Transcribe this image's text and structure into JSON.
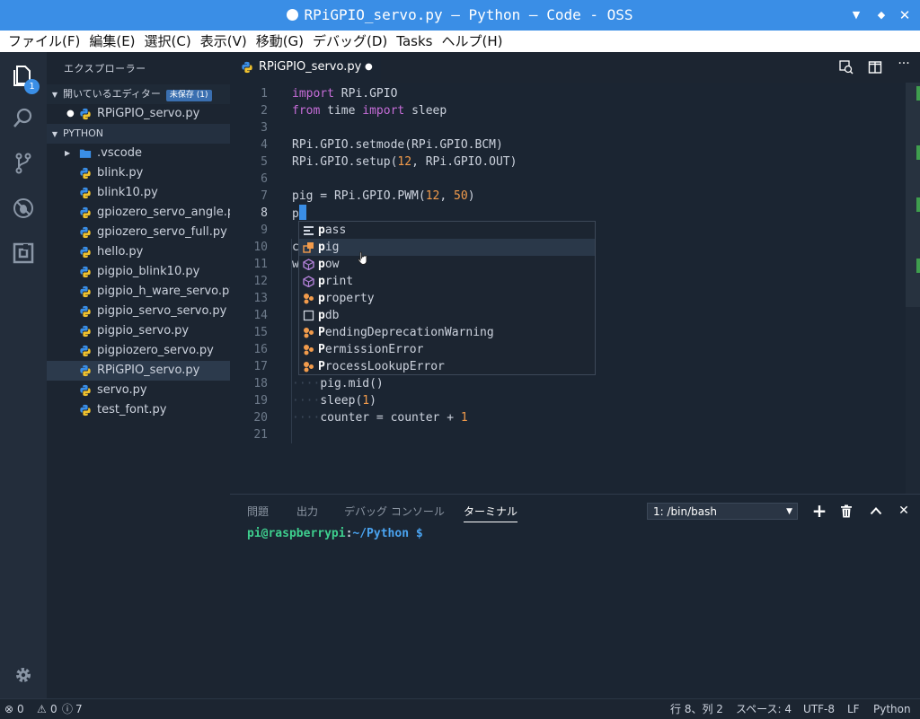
{
  "window": {
    "title": "RPiGPIO_servo.py — Python — Code - OSS"
  },
  "menu": [
    "ファイル(F)",
    "編集(E)",
    "選択(C)",
    "表示(V)",
    "移動(G)",
    "デバッグ(D)",
    "Tasks",
    "ヘルプ(H)"
  ],
  "activity": {
    "explorer_badge": "1"
  },
  "sidebar": {
    "header": "エクスプローラー",
    "open_editors": {
      "label": "開いているエディター",
      "unsaved": "未保存 (1)",
      "items": [
        "RPiGPIO_servo.py"
      ]
    },
    "folder": {
      "label": "PYTHON",
      "items": [
        ".vscode",
        "blink.py",
        "blink10.py",
        "gpiozero_servo_angle.py",
        "gpiozero_servo_full.py",
        "hello.py",
        "pigpio_blink10.py",
        "pigpio_h_ware_servo.py",
        "pigpio_servo_servo.py",
        "pigpio_servo.py",
        "pigpiozero_servo.py",
        "RPiGPIO_servo.py",
        "servo.py",
        "test_font.py"
      ],
      "selected": "RPiGPIO_servo.py"
    }
  },
  "editor": {
    "tab_label": "RPiGPIO_servo.py",
    "line_numbers": [
      "1",
      "2",
      "3",
      "4",
      "5",
      "6",
      "7",
      "8",
      "9",
      "10",
      "11",
      "12",
      "13",
      "14",
      "15",
      "16",
      "17",
      "18",
      "19",
      "20",
      "21"
    ],
    "lines": {
      "l1_kw": "import",
      "l1_rest": " RPi.GPIO",
      "l2_kw1": "from",
      "l2_mid": " time ",
      "l2_kw2": "import",
      "l2_rest": " sleep",
      "l4": "RPi.GPIO.setmode(RPi.GPIO.BCM)",
      "l5_a": "RPi.GPIO.setup(",
      "l5_num": "12",
      "l5_b": ", RPi.GPIO.OUT)",
      "l7_a": "pig = RPi.GPIO.PWM(",
      "l7_num1": "12",
      "l7_sep": ", ",
      "l7_num2": "50",
      "l7_b": ")",
      "l8": "p",
      "l10": "c",
      "l11": "w",
      "l18_ws": "····",
      "l18": "pig.mid()",
      "l19_ws": "····",
      "l19_a": "sleep(",
      "l19_num": "1",
      "l19_b": ")",
      "l20_ws": "····",
      "l20_a": "counter = counter + ",
      "l20_num": "1"
    },
    "suggestions": [
      {
        "match": "p",
        "rest": "ass",
        "icon": "keyword-icon"
      },
      {
        "match": "p",
        "rest": "ig",
        "icon": "variable-icon"
      },
      {
        "match": "p",
        "rest": "ow",
        "icon": "module-icon"
      },
      {
        "match": "p",
        "rest": "rint",
        "icon": "module-icon"
      },
      {
        "match": "p",
        "rest": "roperty",
        "icon": "class-icon"
      },
      {
        "match": "p",
        "rest": "db",
        "icon": "file-icon"
      },
      {
        "match": "P",
        "rest": "endingDeprecationWarning",
        "icon": "class-icon"
      },
      {
        "match": "P",
        "rest": "ermissionError",
        "icon": "class-icon"
      },
      {
        "match": "P",
        "rest": "rocessLookupError",
        "icon": "class-icon"
      }
    ]
  },
  "panel": {
    "tabs": [
      "問題",
      "出力",
      "デバッグ コンソール",
      "ターミナル"
    ],
    "active_tab": "ターミナル",
    "terminal_select": "1: /bin/bash",
    "prompt_user": "pi@raspberrypi",
    "prompt_sep": ":",
    "prompt_path": "~/Python $"
  },
  "status": {
    "errors": "0",
    "warnings": "0",
    "info": "7",
    "position": "行 8、列 2",
    "spaces": "スペース: 4",
    "encoding": "UTF-8",
    "eol": "LF",
    "language": "Python"
  },
  "colors": {
    "accent": "#3a8ee6",
    "keyword": "#c76dd9",
    "number": "#f29b4b",
    "terminal_green": "#3ecf8e",
    "terminal_blue": "#4aa3f0"
  }
}
